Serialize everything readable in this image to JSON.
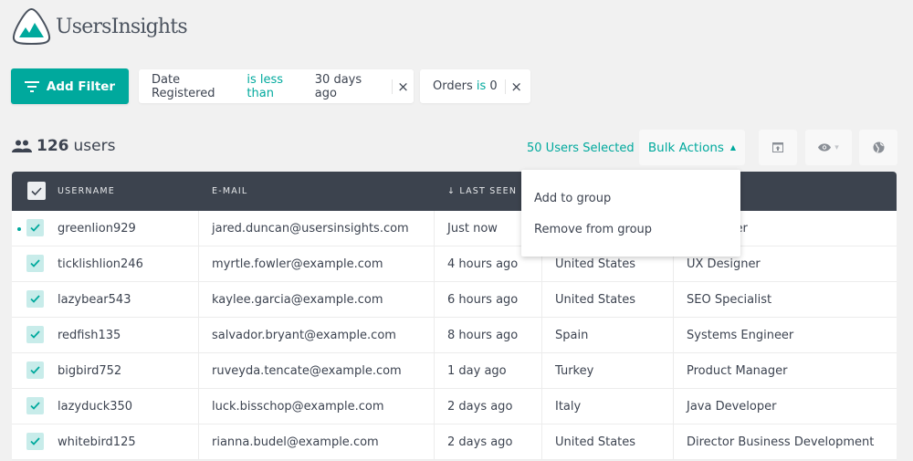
{
  "app": {
    "title": "UsersInsights"
  },
  "filters": {
    "add_label": "Add Filter",
    "chips": [
      {
        "field": "Date Registered",
        "operator": "is less than",
        "value": "30 days ago"
      },
      {
        "field": "Orders",
        "operator": "is",
        "value": "0"
      }
    ],
    "remove_glyph": "×"
  },
  "summary": {
    "count": "126",
    "unit": "users",
    "selected": "50 Users Selected"
  },
  "toolbar": {
    "bulk_actions": "Bulk Actions",
    "bulk_caret": "▲",
    "view_caret": "▾",
    "icons": [
      "export-icon",
      "eye-icon",
      "globe-icon"
    ]
  },
  "bulk_menu": {
    "items": [
      "Add to group",
      "Remove from group"
    ]
  },
  "table": {
    "columns": [
      "USERNAME",
      "E-MAIL",
      "↓ LAST SEEN",
      "",
      ""
    ],
    "rows": [
      {
        "username": "greenlion929",
        "email": "jared.duncan@usersinsights.com",
        "last_seen": "Just now",
        "country": "",
        "job": "Developer",
        "online": true
      },
      {
        "username": "ticklishlion246",
        "email": "myrtle.fowler@example.com",
        "last_seen": "4 hours ago",
        "country": "United States",
        "job": "UX Designer"
      },
      {
        "username": "lazybear543",
        "email": "kaylee.garcia@example.com",
        "last_seen": "6 hours ago",
        "country": "United States",
        "job": "SEO Specialist"
      },
      {
        "username": "redfish135",
        "email": "salvador.bryant@example.com",
        "last_seen": "8 hours ago",
        "country": "Spain",
        "job": "Systems Engineer"
      },
      {
        "username": "bigbird752",
        "email": "ruveyda.tencate@example.com",
        "last_seen": "1 day ago",
        "country": "Turkey",
        "job": "Product Manager"
      },
      {
        "username": "lazyduck350",
        "email": "luck.bisschop@example.com",
        "last_seen": "2 days ago",
        "country": "Italy",
        "job": "Java Developer"
      },
      {
        "username": "whitebird125",
        "email": "rianna.budel@example.com",
        "last_seen": "2 days ago",
        "country": "United States",
        "job": "Director Business Development"
      }
    ]
  },
  "colors": {
    "accent": "#00a99d",
    "header_bg": "#3c434e",
    "page_bg": "#f1f1f1"
  }
}
